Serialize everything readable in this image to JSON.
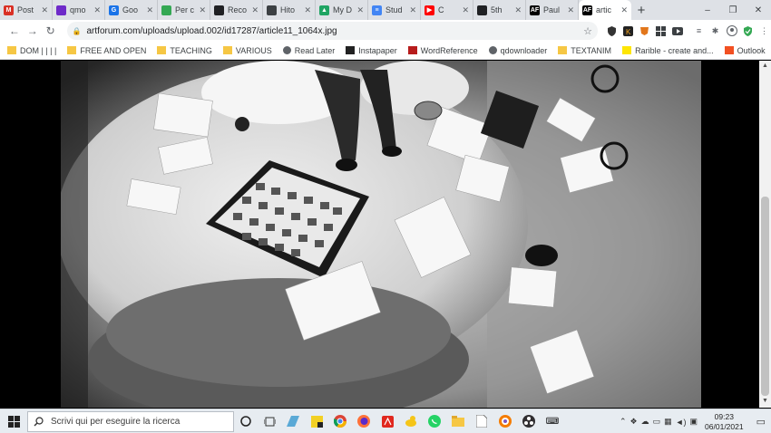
{
  "tabs": [
    {
      "label": "Post",
      "color": "#d93025",
      "icon": "gmail-icon",
      "glyph": "M"
    },
    {
      "label": "qmo",
      "color": "#6e2ac9",
      "icon": "qmo-icon",
      "glyph": ""
    },
    {
      "label": "Goo",
      "color": "#1a73e8",
      "icon": "google-classroom-icon",
      "glyph": "G"
    },
    {
      "label": "Per c",
      "color": "#34a853",
      "icon": "google-sheets-icon",
      "glyph": ""
    },
    {
      "label": "Reco",
      "color": "#202124",
      "icon": "record-icon",
      "glyph": ""
    },
    {
      "label": "Hito",
      "color": "#3c4043",
      "icon": "hito-icon",
      "glyph": ""
    },
    {
      "label": "My D",
      "color": "#1fa463",
      "icon": "google-drive-icon",
      "glyph": "▲"
    },
    {
      "label": "Stud",
      "color": "#4285f4",
      "icon": "google-docs-icon",
      "glyph": "≡"
    },
    {
      "label": "C",
      "color": "#ff0000",
      "icon": "youtube-icon",
      "glyph": "▶"
    },
    {
      "label": "5th",
      "color": "#202124",
      "icon": "fifth-icon",
      "glyph": ""
    },
    {
      "label": "Paul",
      "color": "#000000",
      "icon": "artforum-icon",
      "glyph": "AF"
    },
    {
      "label": "artic",
      "color": "#000000",
      "icon": "artforum-icon",
      "glyph": "AF",
      "active": true
    }
  ],
  "window_controls": {
    "minimize": "–",
    "maximize": "❐",
    "close": "✕"
  },
  "nav": {
    "back": "←",
    "forward": "→",
    "reload": "↻"
  },
  "omnibox": {
    "url": "artforum.com/uploads/upload.002/id17287/article11_1064x.jpg"
  },
  "bookmarks": [
    {
      "label": "DOM | | | |",
      "icon": "folder-icon"
    },
    {
      "label": "FREE AND OPEN",
      "icon": "folder-icon"
    },
    {
      "label": "TEACHING",
      "icon": "folder-icon"
    },
    {
      "label": "VARIOUS",
      "icon": "folder-icon"
    },
    {
      "label": "Read Later",
      "icon": "globe-icon"
    },
    {
      "label": "Instapaper",
      "icon": "instapaper-icon"
    },
    {
      "label": "WordReference",
      "icon": "wordreference-icon"
    },
    {
      "label": "qdownloader",
      "icon": "globe-icon"
    },
    {
      "label": "TEXTANIM",
      "icon": "folder-icon"
    },
    {
      "label": "Rarible - create and...",
      "icon": "rarible-icon"
    },
    {
      "label": "Outlook",
      "icon": "microsoft-icon"
    }
  ],
  "taskbar": {
    "search_placeholder": "Scrivi qui per eseguire la ricerca",
    "time": "09:23",
    "date": "06/01/2021"
  }
}
